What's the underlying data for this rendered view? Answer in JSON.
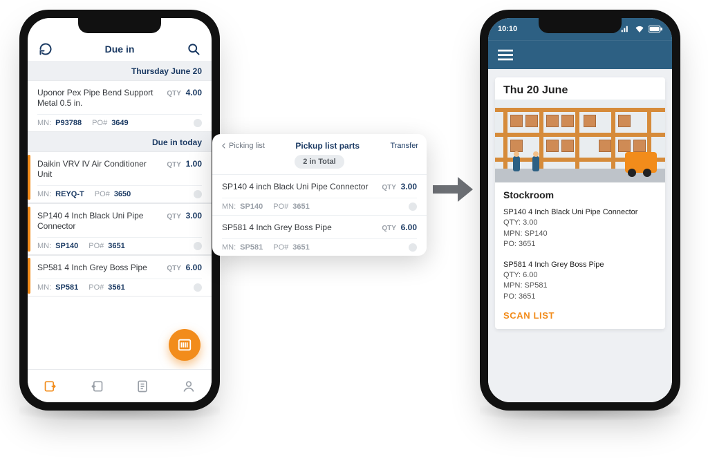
{
  "left": {
    "title": "Due in",
    "sections": [
      {
        "header": "Thursday June 20",
        "items": [
          {
            "title": "Uponor Pex Pipe Bend Support Metal 0.5 in.",
            "qty": "4.00",
            "mn_label": "MN:",
            "mn": "P93788",
            "po_label": "PO#",
            "po": "3649",
            "accent": false
          }
        ]
      },
      {
        "header": "Due in today",
        "items": [
          {
            "title": "Daikin VRV IV Air Conditioner Unit",
            "qty": "1.00",
            "mn_label": "MN:",
            "mn": "REYQ-T",
            "po_label": "PO#",
            "po": "3650",
            "accent": true
          },
          {
            "title": "SP140 4 Inch Black Uni Pipe Connector",
            "qty": "3.00",
            "mn_label": "MN:",
            "mn": "SP140",
            "po_label": "PO#",
            "po": "3651",
            "accent": true
          },
          {
            "title": "SP581 4 Inch Grey Boss Pipe",
            "qty": "6.00",
            "mn_label": "MN:",
            "mn": "SP581",
            "po_label": "PO#",
            "po": "3561",
            "accent": true
          }
        ]
      }
    ],
    "qty_label": "QTY"
  },
  "popup": {
    "back": "Picking list",
    "title": "Pickup list parts",
    "action": "Transfer",
    "total": "2 in Total",
    "items": [
      {
        "title": "SP140 4 inch Black Uni Pipe Connector",
        "qty": "3.00",
        "mn_label": "MN:",
        "mn": "SP140",
        "po_label": "PO#",
        "po": "3651"
      },
      {
        "title": "SP581 4 Inch Grey Boss Pipe",
        "qty": "6.00",
        "mn_label": "MN:",
        "mn": "SP581",
        "po_label": "PO#",
        "po": "3651"
      }
    ],
    "qty_label": "QTY"
  },
  "right": {
    "time": "10:10",
    "date": "Thu 20 June",
    "stock_title": "Stockroom",
    "items": [
      {
        "name": "SP140 4 Inch Black Uni Pipe Connector",
        "qty": "QTY: 3.00",
        "mpn": "MPN: SP140",
        "po": "PO: 3651"
      },
      {
        "name": "SP581 4 Inch Grey Boss Pipe",
        "qty": "QTY: 6.00",
        "mpn": "MPN: SP581",
        "po": "PO: 3651"
      }
    ],
    "scan": "SCAN LIST"
  }
}
